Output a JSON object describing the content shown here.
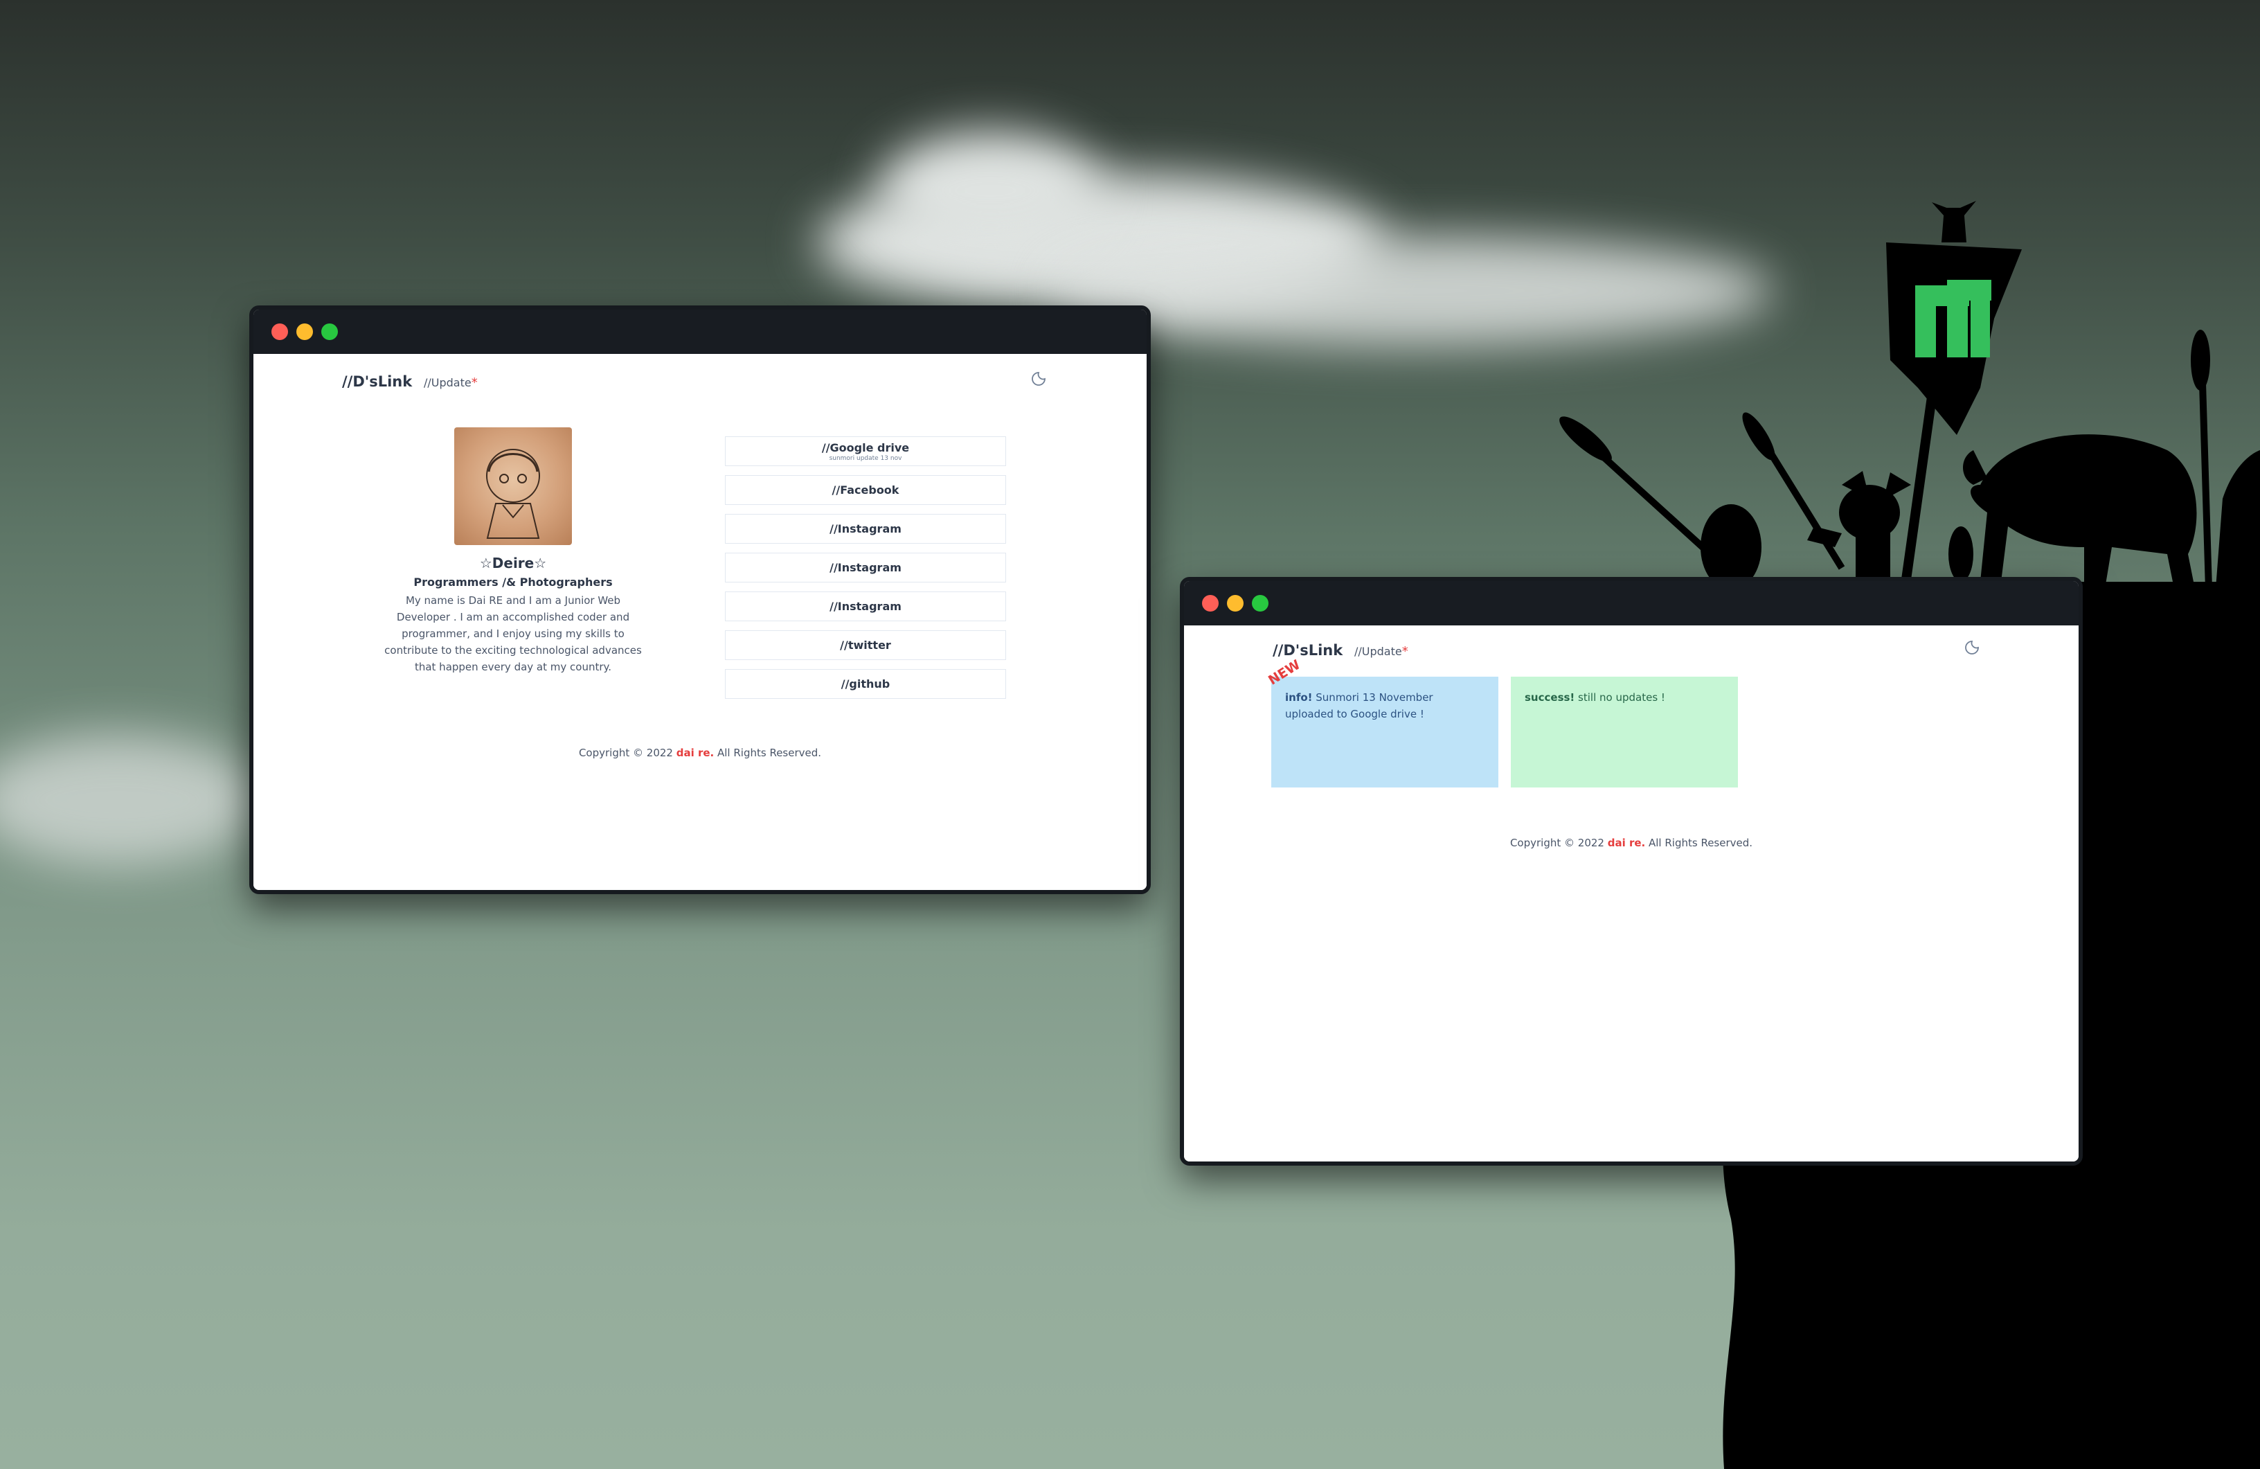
{
  "colors": {
    "accent_red": "#e53e3e",
    "text_dark": "#2d3748",
    "info_bg": "#bee3f8",
    "success_bg": "#c6f6d5",
    "titlebar": "#181c22"
  },
  "window_profile": {
    "nav": {
      "brand": "//D'sLink",
      "update_label": "//Update",
      "update_marker": "*",
      "theme_icon": "moon-icon"
    },
    "profile": {
      "avatar_icon": "avatar-drawing",
      "name": "☆Deire☆",
      "role": "Programmers /& Photographers",
      "bio_lines": [
        "My name is Dai RE and I am a Junior Web",
        "Developer . I am an accomplished coder and",
        "programmer, and I enjoy using my skills to",
        "contribute to the exciting technological advances",
        "that happen every day at my country."
      ]
    },
    "links": [
      {
        "label": "//Google drive",
        "sub": "sunmori update 13 nov"
      },
      {
        "label": "//Facebook"
      },
      {
        "label": "//Instagram"
      },
      {
        "label": "//Instagram"
      },
      {
        "label": "//Instagram"
      },
      {
        "label": "//twitter"
      },
      {
        "label": "//github"
      }
    ],
    "footer": {
      "prefix": "Copyright © 2022 ",
      "author": "dai re.",
      "suffix": " All Rights Reserved."
    }
  },
  "window_update": {
    "nav": {
      "brand": "//D'sLink",
      "update_label": "//Update",
      "update_marker": "*",
      "theme_icon": "moon-icon"
    },
    "new_badge": "NEW",
    "info_alert": {
      "title": "info!",
      "text_line1": "Sunmori 13 November",
      "text_line2": "uploaded to Google drive !"
    },
    "success_alert": {
      "title": "success!",
      "text": "still no updates !"
    },
    "footer": {
      "prefix": "Copyright © 2022 ",
      "author": "dai re.",
      "suffix": " All Rights Reserved."
    }
  }
}
